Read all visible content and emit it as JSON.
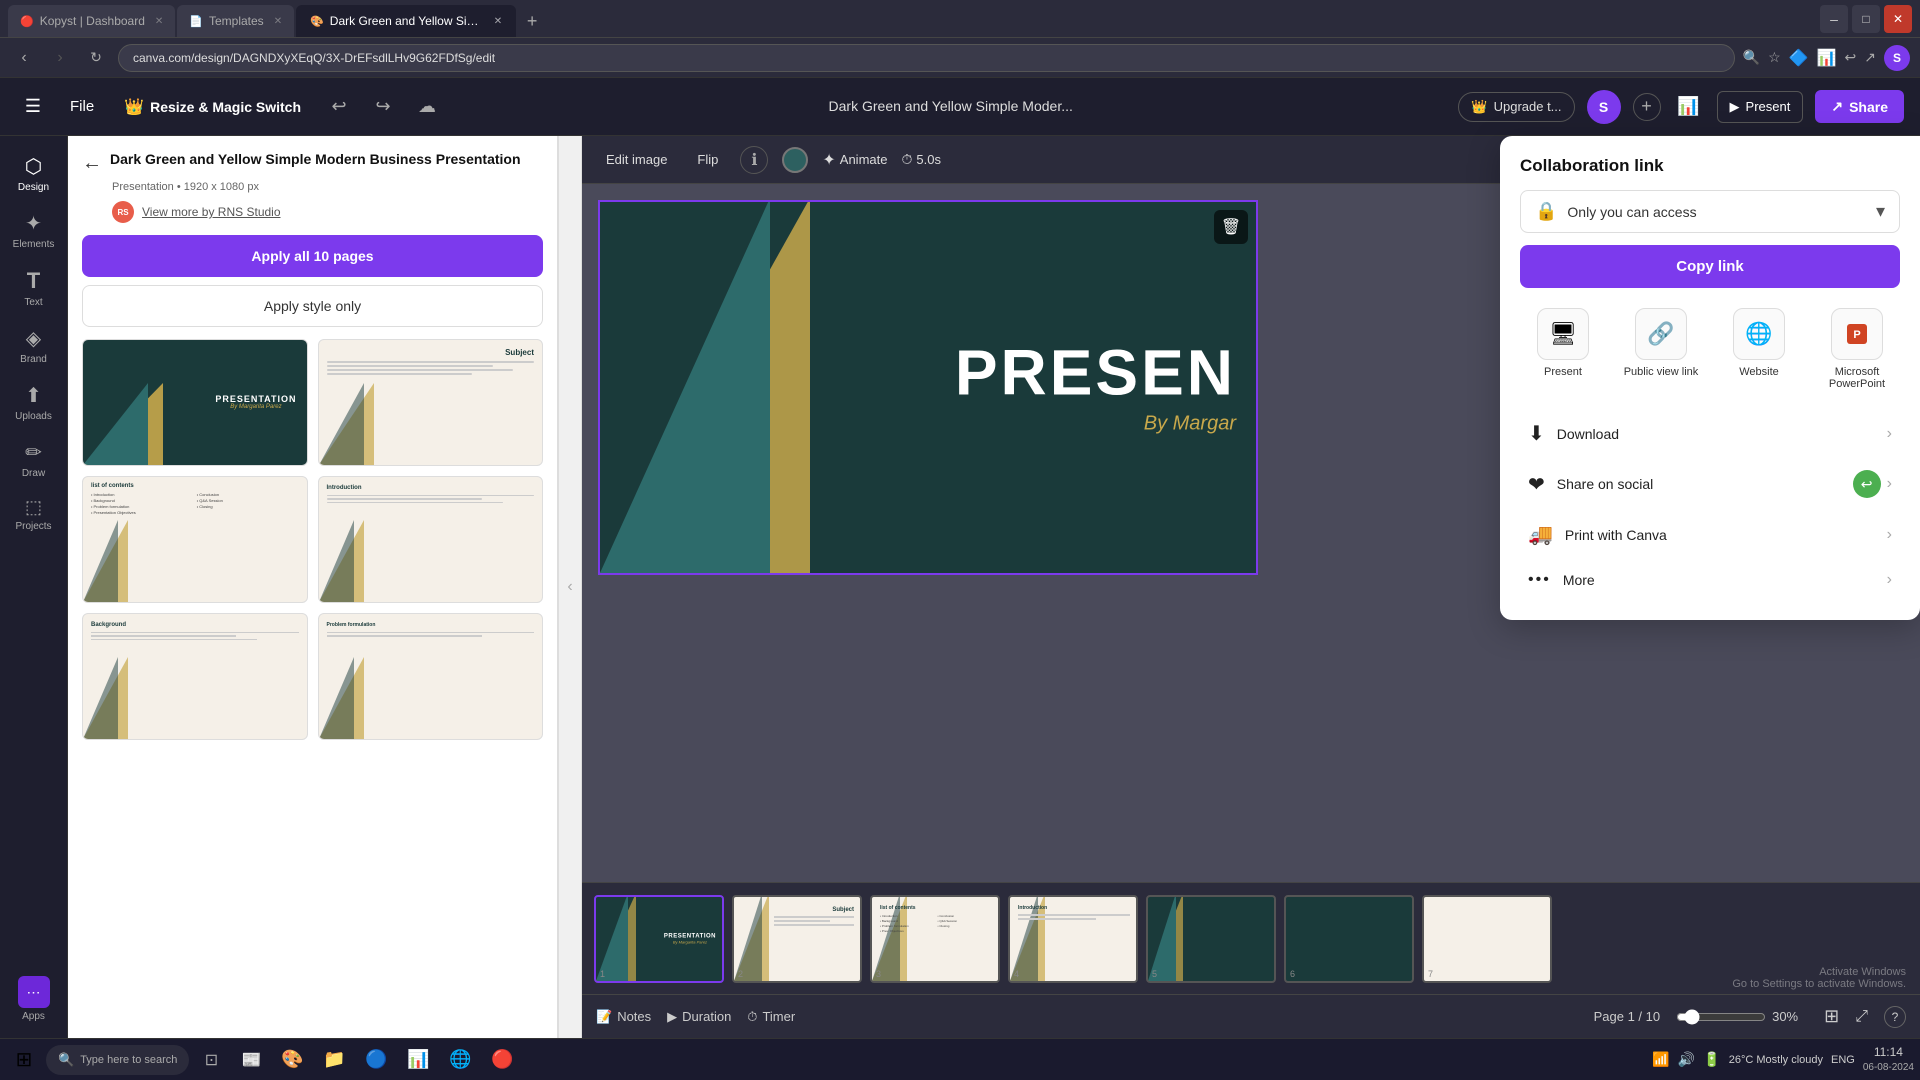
{
  "browser": {
    "tabs": [
      {
        "id": "tab1",
        "label": "Kopyst | Dashboard",
        "favicon": "🔴",
        "active": false
      },
      {
        "id": "tab2",
        "label": "Templates",
        "favicon": "🟡",
        "active": false
      },
      {
        "id": "tab3",
        "label": "Dark Green and Yellow Simple ...",
        "favicon": "🔵",
        "active": true
      }
    ],
    "url": "canva.com/design/DAGNDXyXEqQ/3X-DrEFsdlLHv9G62FDfSg/edit"
  },
  "app_header": {
    "file_label": "File",
    "resize_magic_label": "Resize & Magic Switch",
    "title": "Dark Green and Yellow Simple Moder...",
    "upgrade_label": "Upgrade t...",
    "user_initial": "S",
    "present_label": "Present",
    "share_label": "Share"
  },
  "sidebar": {
    "items": [
      {
        "id": "design",
        "label": "Design",
        "icon": "⬡",
        "active": true
      },
      {
        "id": "elements",
        "label": "Elements",
        "icon": "✦"
      },
      {
        "id": "text",
        "label": "Text",
        "icon": "T"
      },
      {
        "id": "brand",
        "label": "Brand",
        "icon": "◈"
      },
      {
        "id": "uploads",
        "label": "Uploads",
        "icon": "⬆"
      },
      {
        "id": "draw",
        "label": "Draw",
        "icon": "✏"
      },
      {
        "id": "projects",
        "label": "Projects",
        "icon": "⬚"
      }
    ]
  },
  "template_panel": {
    "title": "Dark Green and Yellow Simple Modern Business Presentation",
    "subtitle": "Presentation • 1920 x 1080 px",
    "author_initials": "RS",
    "author_name": "View more by RNS Studio",
    "apply_all_label": "Apply all 10 pages",
    "apply_style_label": "Apply style only",
    "thumbnails": [
      {
        "id": "thumb1",
        "type": "dark",
        "title": "PRESENTATION",
        "subtitle": "By Margarita Parez"
      },
      {
        "id": "thumb2",
        "type": "light",
        "title": "Subject",
        "lines": 4
      },
      {
        "id": "thumb3",
        "type": "light-cols",
        "title": "list of contents",
        "columns": [
          "Introduction",
          "Background",
          "Problem formulation",
          "Presentation Objectives",
          "Conclusion",
          "Q&A Session",
          "Closing"
        ]
      },
      {
        "id": "thumb4",
        "type": "light-intro",
        "title": "Introduction",
        "lines": 3
      },
      {
        "id": "thumb5",
        "type": "light",
        "title": "Background",
        "lines": 3
      },
      {
        "id": "thumb6",
        "type": "light",
        "title": "Problem formulation",
        "lines": 3
      }
    ]
  },
  "image_toolbar": {
    "edit_image": "Edit image",
    "flip": "Flip",
    "animate": "Animate",
    "duration": "5.0s"
  },
  "slide": {
    "title": "PRESEN",
    "subtitle": "By Margar",
    "page": "1",
    "total_pages": "10"
  },
  "filmstrip": {
    "slides": [
      {
        "id": 1,
        "type": "presentation",
        "label": "PRESENTATION",
        "sublabel": "By Margarita Parez",
        "active": true
      },
      {
        "id": 2,
        "type": "subject",
        "label": "Subject"
      },
      {
        "id": 3,
        "type": "toc",
        "label": "list of contents"
      },
      {
        "id": 4,
        "type": "dark-text",
        "label": "Introduction"
      },
      {
        "id": 5,
        "type": "dark-text",
        "label": ""
      },
      {
        "id": 6,
        "type": "dark-text",
        "label": ""
      },
      {
        "id": 7,
        "type": "dark-text",
        "label": ""
      }
    ]
  },
  "bottom_bar": {
    "notes_label": "Notes",
    "duration_label": "Duration",
    "timer_label": "Timer",
    "page_label": "Page 1 / 10",
    "zoom_pct": "30%"
  },
  "share_panel": {
    "title": "Collaboration link",
    "access_label": "Only you can access",
    "copy_link_label": "Copy link",
    "options": [
      {
        "id": "present",
        "label": "Present",
        "icon": "🖥"
      },
      {
        "id": "public_view",
        "label": "Public view link",
        "icon": "🔗"
      },
      {
        "id": "website",
        "label": "Website",
        "icon": "🌐"
      },
      {
        "id": "powerpoint",
        "label": "Microsoft PowerPoint",
        "icon": "📊"
      }
    ],
    "menu_items": [
      {
        "id": "download",
        "label": "Download",
        "icon": "⬇"
      },
      {
        "id": "social",
        "label": "Share on social",
        "icon": "❤"
      },
      {
        "id": "print",
        "label": "Print with Canva",
        "icon": "🚚"
      },
      {
        "id": "more",
        "label": "More",
        "icon": "···"
      }
    ]
  },
  "taskbar": {
    "search_placeholder": "Type here to search",
    "clock_time": "11:14",
    "clock_date": "06-08-2024",
    "weather": "26°C  Mostly cloudy",
    "lang": "ENG"
  },
  "activate_windows": {
    "line1": "Activate Windows",
    "line2": "Go to Settings to activate Windows."
  }
}
